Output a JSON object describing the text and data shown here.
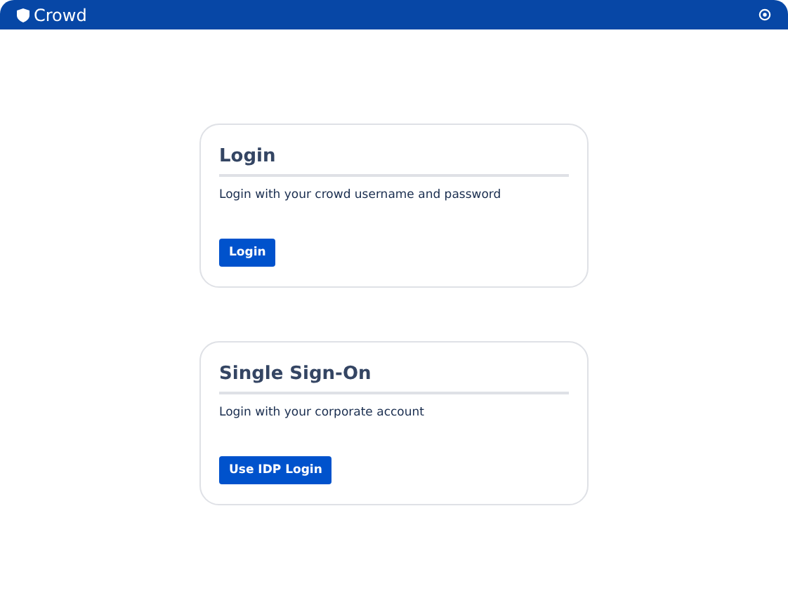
{
  "header": {
    "title": "Crowd"
  },
  "cards": [
    {
      "title": "Login",
      "description": "Login with your crowd username and password",
      "button": "Login"
    },
    {
      "title": "Single Sign-On",
      "description": "Login with your corporate account",
      "button": "Use IDP Login"
    }
  ]
}
